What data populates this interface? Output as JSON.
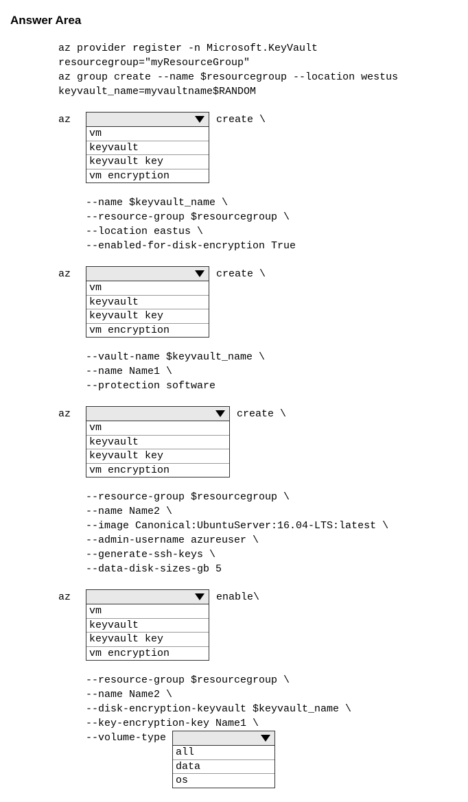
{
  "heading": "Answer Area",
  "intro_lines": [
    "az provider register -n Microsoft.KeyVault",
    "resourcegroup=\"myResourceGroup\"",
    "az group create --name $resourcegroup --location westus",
    "keyvault_name=myvaultname$RANDOM"
  ],
  "dd_options": [
    "vm",
    "keyvault",
    "keyvault key",
    "vm encryption"
  ],
  "b1": {
    "az": "az",
    "after": "create \\",
    "params": [
      "--name $keyvault_name \\",
      "--resource-group $resourcegroup \\",
      "--location eastus \\",
      "--enabled-for-disk-encryption True"
    ]
  },
  "b2": {
    "az": "az",
    "after": "create \\",
    "params": [
      "--vault-name $keyvault_name \\",
      "--name Name1 \\",
      "--protection software"
    ]
  },
  "b3": {
    "az": "az",
    "after": "create \\",
    "params": [
      "--resource-group $resourcegroup \\",
      "--name Name2 \\",
      "--image Canonical:UbuntuServer:16.04-LTS:latest \\",
      "--admin-username azureuser \\",
      "--generate-ssh-keys \\",
      "--data-disk-sizes-gb 5"
    ]
  },
  "b4": {
    "az": "az",
    "after": "enable\\",
    "params": [
      "--resource-group $resourcegroup \\",
      "--name Name2 \\",
      "--disk-encryption-keyvault $keyvault_name \\",
      "--key-encryption-key Name1 \\"
    ],
    "vol_label": "--volume-type ",
    "vol_options": [
      "all",
      "data",
      "os"
    ]
  }
}
